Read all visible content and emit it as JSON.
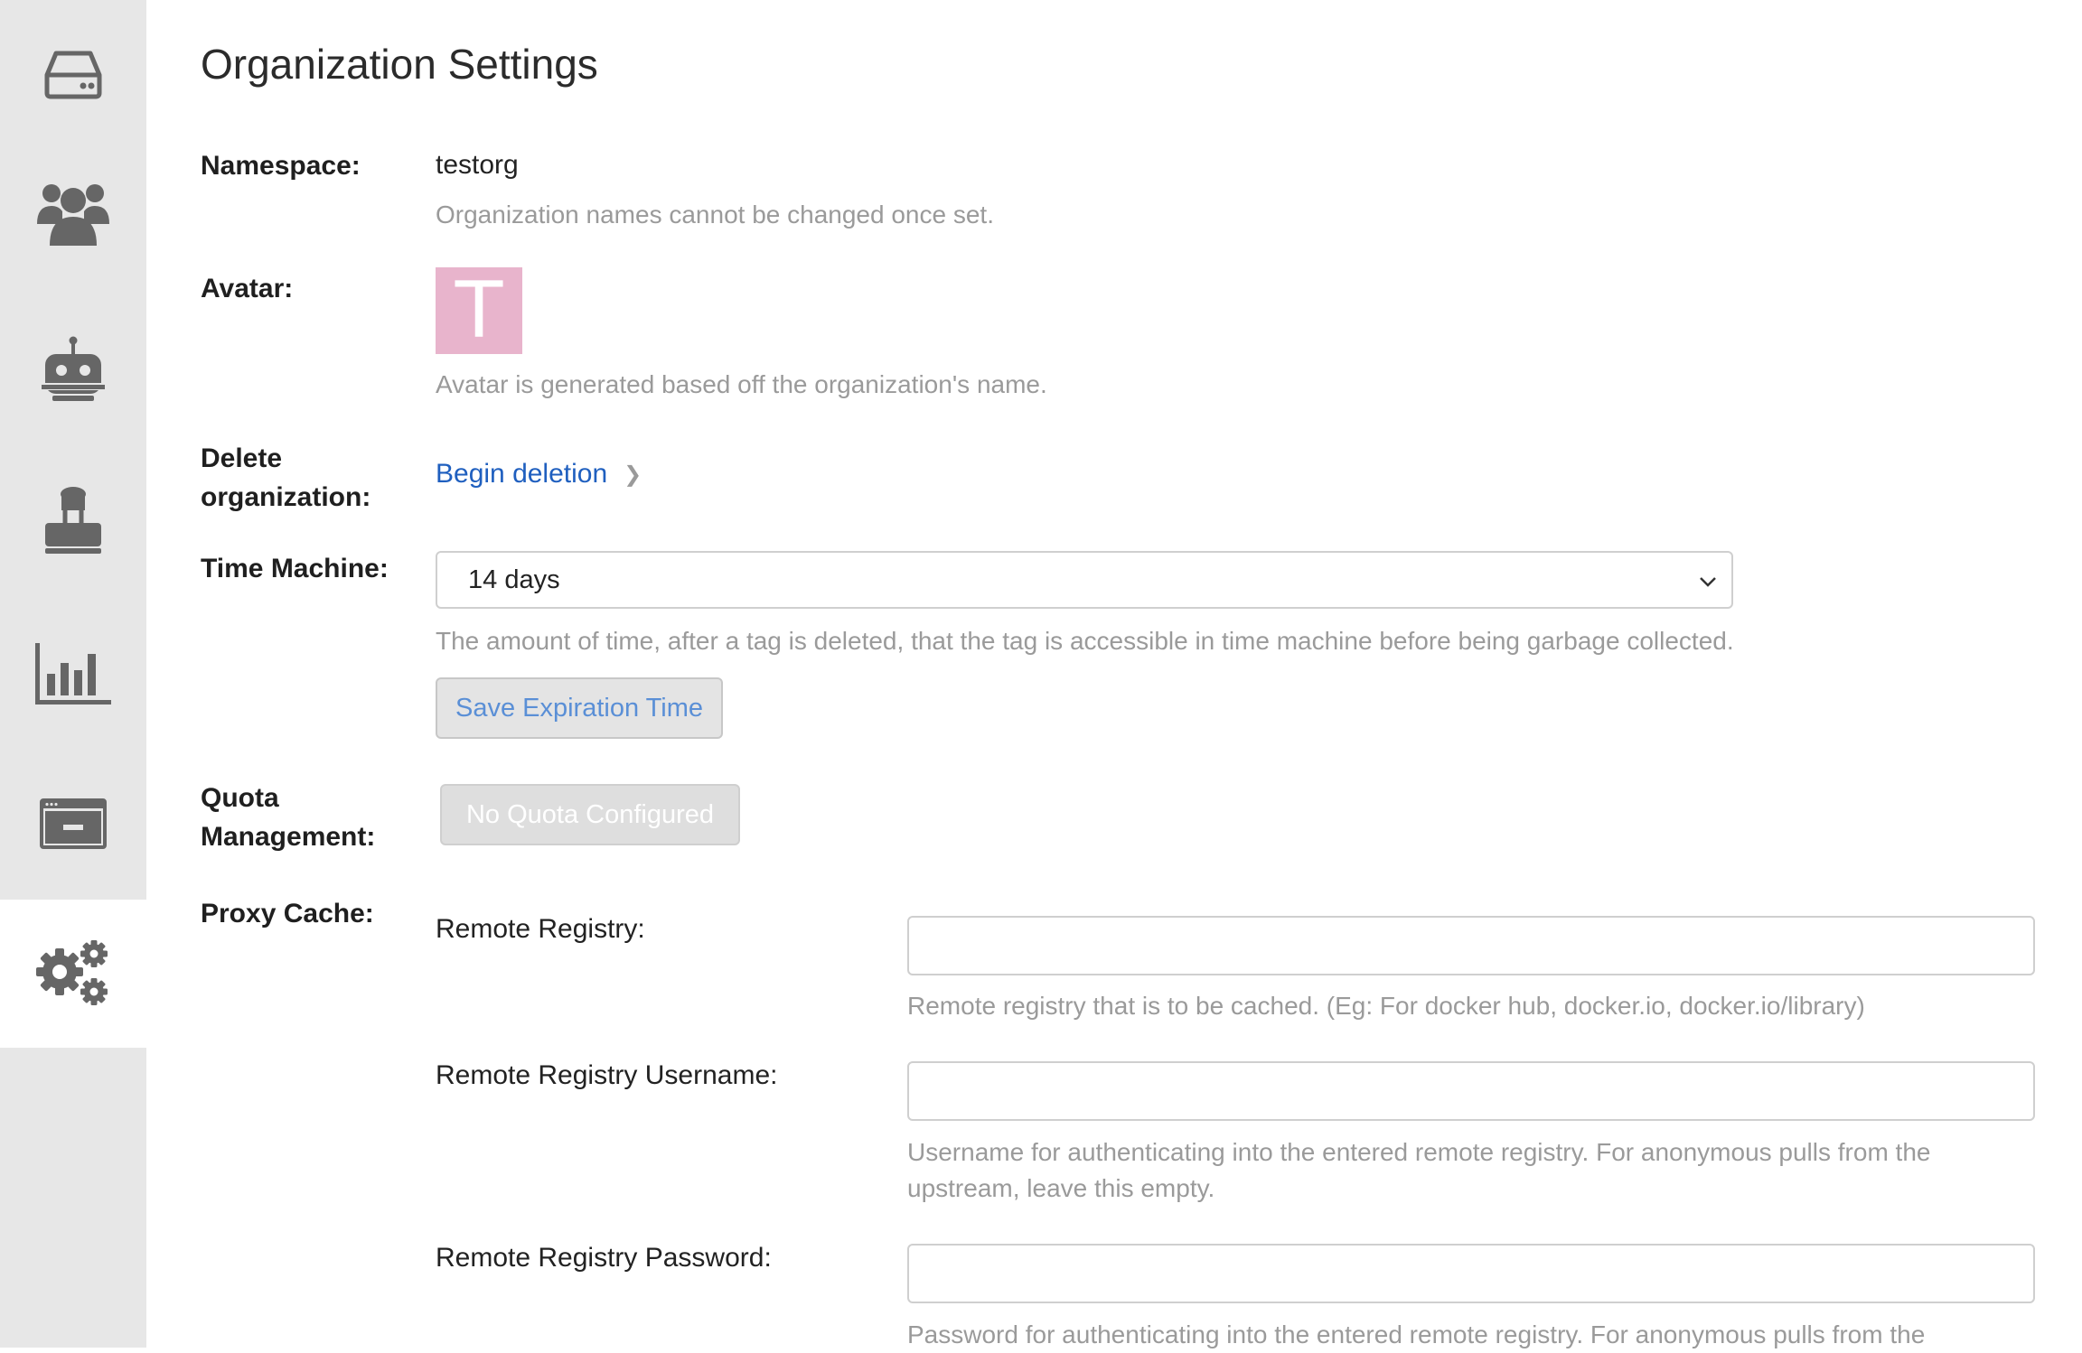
{
  "sidebar": {
    "items": [
      {
        "icon": "hard-drive-icon",
        "active": false
      },
      {
        "icon": "users-icon",
        "active": false
      },
      {
        "icon": "robot-icon",
        "active": false
      },
      {
        "icon": "stamp-icon",
        "active": false
      },
      {
        "icon": "bar-chart-icon",
        "active": false
      },
      {
        "icon": "browser-window-icon",
        "active": false
      },
      {
        "icon": "gears-icon",
        "active": true
      }
    ]
  },
  "page": {
    "title": "Organization Settings"
  },
  "namespace": {
    "label": "Namespace:",
    "value": "testorg",
    "help": "Organization names cannot be changed once set."
  },
  "avatar": {
    "label": "Avatar:",
    "letter": "T",
    "color": "#e8b4cc",
    "help": "Avatar is generated based off the organization's name."
  },
  "delete_org": {
    "label_line1": "Delete",
    "label_line2": "organization:",
    "link": "Begin deletion"
  },
  "time_machine": {
    "label": "Time Machine:",
    "selected": "14 days",
    "help": "The amount of time, after a tag is deleted, that the tag is accessible in time machine before being garbage collected.",
    "save_button": "Save Expiration Time"
  },
  "quota": {
    "label_line1": "Quota",
    "label_line2": "Management:",
    "button": "No Quota Configured"
  },
  "proxy_cache": {
    "label": "Proxy Cache:",
    "remote_registry": {
      "label": "Remote Registry:",
      "value": "",
      "help": "Remote registry that is to be cached. (Eg: For docker hub, docker.io, docker.io/library)"
    },
    "username": {
      "label": "Remote Registry Username:",
      "value": "",
      "help_line1": "Username for authenticating into the entered remote registry. For anonymous pulls from the",
      "help_line2": "upstream, leave this empty."
    },
    "password": {
      "label": "Remote Registry Password:",
      "value": "",
      "help_line1": "Password for authenticating into the entered remote registry. For anonymous pulls from the"
    }
  },
  "colors": {
    "link": "#1f5fbf",
    "sidebar_bg": "#e7e7e7",
    "icon": "#666666"
  }
}
